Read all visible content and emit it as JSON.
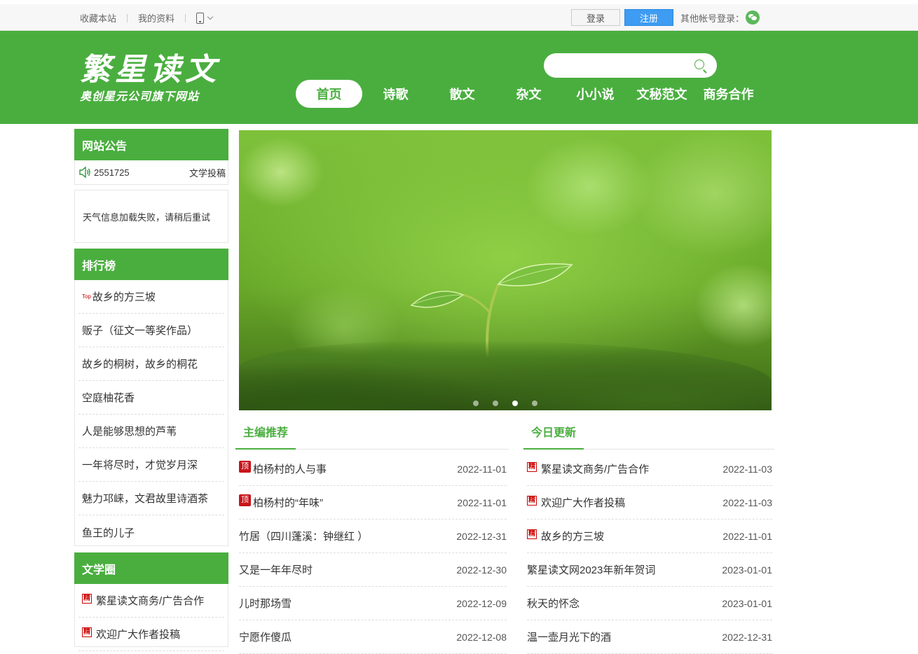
{
  "topbar": {
    "bookmark": "收藏本站",
    "profile": "我的资料",
    "login": "登录",
    "register": "注册",
    "other_login": "其他帐号登录："
  },
  "header": {
    "logo_title": "繁星读文",
    "logo_subtitle": "奥创星元公司旗下网站",
    "search_placeholder": "",
    "nav": [
      "首页",
      "诗歌",
      "散文",
      "杂文",
      "小小说",
      "文秘范文",
      "商务合作"
    ]
  },
  "sidebar": {
    "notice_title": "网站公告",
    "notice_text": "2551725",
    "notice_text2": "文学投稿",
    "weather_text": "天气信息加载失败，请稍后重试",
    "rank_title": "排行榜",
    "rank_top_label": "Top",
    "rank_items": [
      "故乡的方三坡",
      "贩子（征文一等奖作品）",
      "故乡的桐树，故乡的桐花",
      "空庭柚花香",
      "人是能够思想的芦苇",
      "一年将尽时，才觉岁月深",
      "魅力邛崃，文君故里诗酒茶",
      "鱼王的儿子"
    ],
    "lit_title": "文学圈",
    "lit_tag": "精",
    "lit_items": [
      "繁星读文商务/广告合作",
      "欢迎广大作者投稿"
    ]
  },
  "editor_pick": {
    "title": "主编推荐",
    "top_tag": "顶",
    "items": [
      {
        "title": "柏杨村的人与事",
        "date": "2022-11-01",
        "top": true
      },
      {
        "title": "柏杨村的“年味”",
        "date": "2022-11-01",
        "top": true
      },
      {
        "title": "竹居（四川蓬溪：钟继红 ）",
        "date": "2022-12-31",
        "top": false
      },
      {
        "title": "又是一年年尽时",
        "date": "2022-12-30",
        "top": false
      },
      {
        "title": "儿时那场雪",
        "date": "2022-12-09",
        "top": false
      },
      {
        "title": "宁愿作傻瓜",
        "date": "2022-12-08",
        "top": false
      }
    ]
  },
  "today_update": {
    "title": "今日更新",
    "tag": "精",
    "items": [
      {
        "title": "繁星读文商务/广告合作",
        "date": "2022-11-03",
        "tag": true
      },
      {
        "title": "欢迎广大作者投稿",
        "date": "2022-11-03",
        "tag": true
      },
      {
        "title": "故乡的方三坡",
        "date": "2022-11-01",
        "tag": true
      },
      {
        "title": "繁星读文网2023年新年贺词",
        "date": "2023-01-01",
        "tag": false
      },
      {
        "title": "秋天的怀念",
        "date": "2023-01-01",
        "tag": false
      },
      {
        "title": "温一壶月光下的酒",
        "date": "2022-12-31",
        "tag": false
      }
    ]
  },
  "banner": {
    "slides": 4,
    "active_slide": 3
  }
}
